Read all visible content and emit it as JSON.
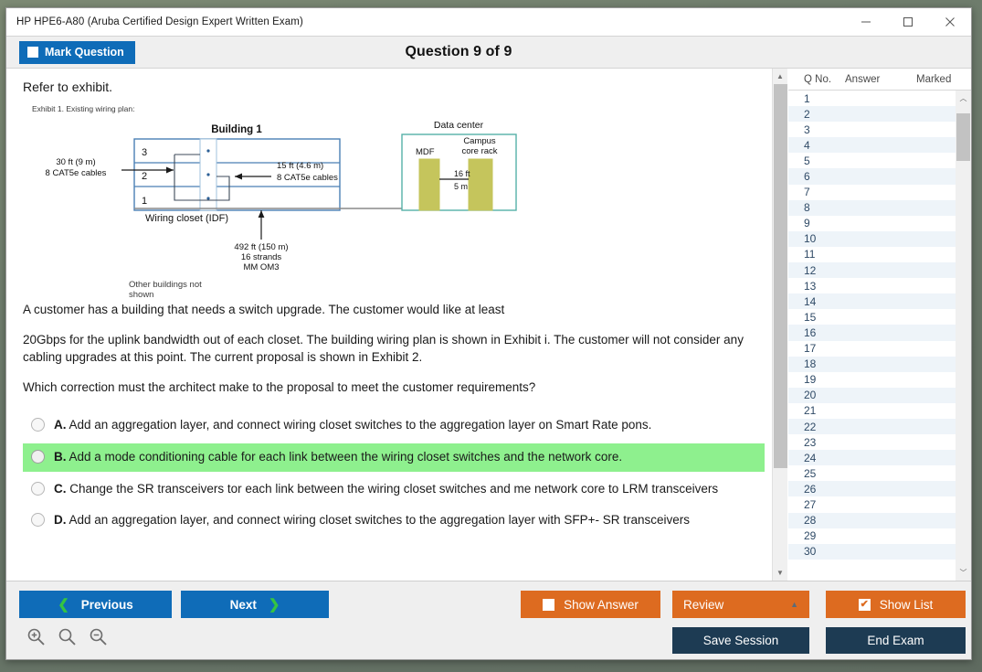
{
  "window": {
    "title": "HP HPE6-A80 (Aruba Certified Design Expert Written Exam)",
    "minimize_label": "minimize",
    "maximize_label": "maximize",
    "close_label": "close"
  },
  "header": {
    "mark_question_label": "Mark Question",
    "question_title": "Question 9 of 9"
  },
  "content": {
    "refer_text": "Refer to exhibit.",
    "exhibit_caption": "Exhibit 1. Existing wiring plan:",
    "diagram": {
      "building_title": "Building 1",
      "datacenter_title": "Data center",
      "floor_3": "3",
      "floor_2": "2",
      "floor_1": "1",
      "wiring_closet_label": "Wiring closet (IDF)",
      "left_cable_line1": "30 ft (9 m)",
      "left_cable_line2": "8 CAT5e cables",
      "right_cable_line1": "15 ft (4.6 m)",
      "right_cable_line2": "8 CAT5e cables",
      "fiber_line1": "492 ft (150 m)",
      "fiber_line2": "16 strands",
      "fiber_line3": "MM OM3",
      "mdf_label": "MDF",
      "core_rack_line1": "Campus",
      "core_rack_line2": "core rack",
      "dc_distance_line1": "16 ft",
      "dc_distance_line2": "5 m",
      "other_buildings_line1": "Other buildings not",
      "other_buildings_line2": "shown"
    },
    "question_paragraphs": [
      "A customer has a building that needs a switch upgrade. The customer would like at least",
      "20Gbps for the uplink bandwidth out of each closet. The building wiring plan is shown in Exhibit i. The customer will not consider any cabling upgrades at this point. The current proposal is shown in Exhibit 2.",
      "Which correction must the architect make to the proposal to meet the customer requirements?"
    ],
    "options": [
      {
        "letter": "A.",
        "text": "Add an aggregation layer, and connect wiring closet switches to the aggregation layer on Smart Rate pons.",
        "selected": false
      },
      {
        "letter": "B.",
        "text": "Add a mode conditioning cable for each link between the wiring closet switches and the network core.",
        "selected": true
      },
      {
        "letter": "C.",
        "text": "Change the SR transceivers tor each link between the wiring closet switches and me network core to LRM transceivers",
        "selected": false
      },
      {
        "letter": "D.",
        "text": "Add an aggregation layer, and connect wiring closet switches to the aggregation layer with SFP+- SR transceivers",
        "selected": false
      }
    ]
  },
  "question_list": {
    "columns": [
      "Q No.",
      "Answer",
      "Marked"
    ],
    "rows": [
      {
        "q": "1",
        "answer": "",
        "marked": ""
      },
      {
        "q": "2",
        "answer": "",
        "marked": ""
      },
      {
        "q": "3",
        "answer": "",
        "marked": ""
      },
      {
        "q": "4",
        "answer": "",
        "marked": ""
      },
      {
        "q": "5",
        "answer": "",
        "marked": ""
      },
      {
        "q": "6",
        "answer": "",
        "marked": ""
      },
      {
        "q": "7",
        "answer": "",
        "marked": ""
      },
      {
        "q": "8",
        "answer": "",
        "marked": ""
      },
      {
        "q": "9",
        "answer": "",
        "marked": ""
      },
      {
        "q": "10",
        "answer": "",
        "marked": ""
      },
      {
        "q": "11",
        "answer": "",
        "marked": ""
      },
      {
        "q": "12",
        "answer": "",
        "marked": ""
      },
      {
        "q": "13",
        "answer": "",
        "marked": ""
      },
      {
        "q": "14",
        "answer": "",
        "marked": ""
      },
      {
        "q": "15",
        "answer": "",
        "marked": ""
      },
      {
        "q": "16",
        "answer": "",
        "marked": ""
      },
      {
        "q": "17",
        "answer": "",
        "marked": ""
      },
      {
        "q": "18",
        "answer": "",
        "marked": ""
      },
      {
        "q": "19",
        "answer": "",
        "marked": ""
      },
      {
        "q": "20",
        "answer": "",
        "marked": ""
      },
      {
        "q": "21",
        "answer": "",
        "marked": ""
      },
      {
        "q": "22",
        "answer": "",
        "marked": ""
      },
      {
        "q": "23",
        "answer": "",
        "marked": ""
      },
      {
        "q": "24",
        "answer": "",
        "marked": ""
      },
      {
        "q": "25",
        "answer": "",
        "marked": ""
      },
      {
        "q": "26",
        "answer": "",
        "marked": ""
      },
      {
        "q": "27",
        "answer": "",
        "marked": ""
      },
      {
        "q": "28",
        "answer": "",
        "marked": ""
      },
      {
        "q": "29",
        "answer": "",
        "marked": ""
      },
      {
        "q": "30",
        "answer": "",
        "marked": ""
      }
    ]
  },
  "footer": {
    "previous_label": "Previous",
    "next_label": "Next",
    "show_answer_label": "Show Answer",
    "review_label": "Review",
    "show_list_label": "Show List",
    "save_session_label": "Save Session",
    "end_exam_label": "End Exam",
    "zoom_in_label": "zoom-in",
    "zoom_reset_label": "zoom-reset",
    "zoom_out_label": "zoom-out"
  },
  "colors": {
    "primary_blue": "#0f6cb8",
    "orange": "#dd6b20",
    "navy": "#1d3b53",
    "selected_green": "#8ef08e",
    "rack_olive": "#c5c55c",
    "diagram_blue": "#3f6fa8",
    "diagram_teal": "#4aa8a0"
  }
}
